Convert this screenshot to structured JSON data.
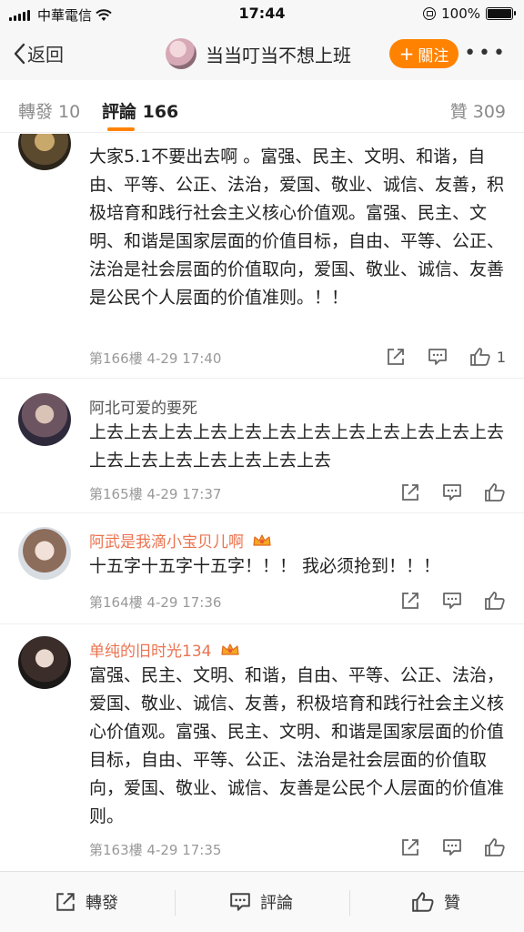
{
  "status_bar": {
    "carrier": "中華電信",
    "time": "17:44",
    "battery": "100%"
  },
  "nav": {
    "back_label": "返回",
    "title": "当当叮当不想上班",
    "follow_label": "關注",
    "more_label": "•••"
  },
  "tabs": {
    "repost": "轉發 10",
    "comment": "評論 166",
    "like": "贊 309"
  },
  "comments": [
    {
      "username": "",
      "text": "大家5.1不要出去啊 。富强、民主、文明、和谐，自由、平等、公正、法治，爱国、敬业、诚信、友善，积极培育和践行社会主义核心价值观。富强、民主、文明、和谐是国家层面的价值目标，自由、平等、公正、法治是社会层面的价值取向，爱国、敬业、诚信、友善是公民个人层面的价值准则。！！",
      "meta": "第166樓  4-29 17:40",
      "likes": "1"
    },
    {
      "username": "阿北可爱的要死",
      "text": "上去上去上去上去上去上去上去上去上去上去上去上去上去上去上去上去上去上去上去",
      "meta": "第165樓  4-29 17:37",
      "likes": ""
    },
    {
      "username": "阿武是我滴小宝贝儿啊",
      "text": "十五字十五字十五字！！！ 我必须抢到！！！",
      "meta": "第164樓  4-29 17:36",
      "likes": ""
    },
    {
      "username": "单纯的旧时光134",
      "text": "富强、民主、文明、和谐，自由、平等、公正、法治，爱国、敬业、诚信、友善，积极培育和践行社会主义核心价值观。富强、民主、文明、和谐是国家层面的价值目标，自由、平等、公正、法治是社会层面的价值取向，爱国、敬业、诚信、友善是公民个人层面的价值准则。",
      "meta": "第163樓  4-29 17:35",
      "likes": ""
    }
  ],
  "bottom_bar": {
    "repost": "轉發",
    "comment": "評論",
    "like": "贊"
  },
  "colors": {
    "accent": "#ff8200",
    "vip_name": "#eb7350"
  },
  "icons": {
    "share": "share-icon",
    "reply": "comment-icon",
    "like": "thumb-up-icon",
    "crown": "vip-crown-icon"
  }
}
